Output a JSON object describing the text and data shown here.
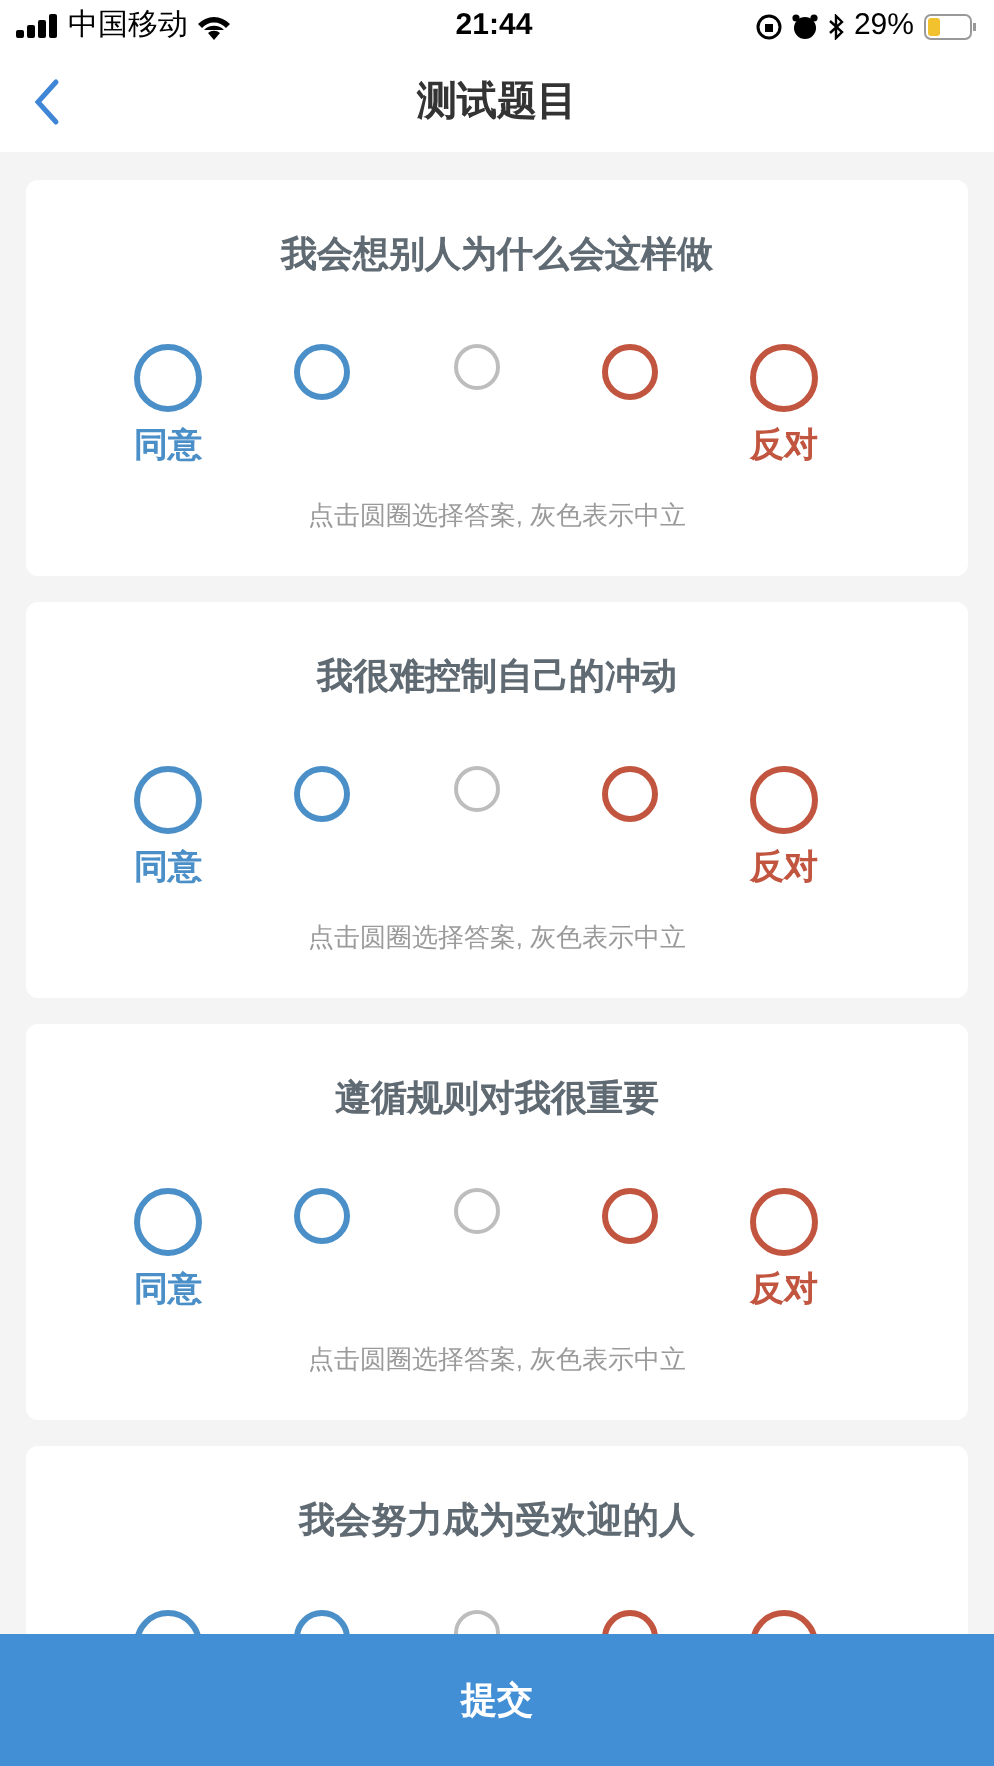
{
  "status_bar": {
    "carrier": "中国移动",
    "time": "21:44",
    "battery": "29%"
  },
  "nav": {
    "title": "测试题目"
  },
  "questions": [
    {
      "title": "我会想别人为什么会这样做",
      "hint": "点击圆圈选择答案, 灰色表示中立",
      "options": [
        {
          "kind": "large",
          "color": "#4a8fc8",
          "selected": false,
          "label": "同意"
        },
        {
          "kind": "medium",
          "color": "#4a8fc8",
          "selected": false
        },
        {
          "kind": "small",
          "color": "#bdbdbd",
          "selected": false
        },
        {
          "kind": "medium",
          "color": "#c2553f",
          "selected": false
        },
        {
          "kind": "large",
          "color": "#c2553f",
          "selected": false,
          "label": "反对"
        }
      ]
    },
    {
      "title": "我很难控制自己的冲动",
      "hint": "点击圆圈选择答案, 灰色表示中立",
      "options": [
        {
          "kind": "large",
          "color": "#4a8fc8",
          "selected": false,
          "label": "同意"
        },
        {
          "kind": "medium",
          "color": "#4a8fc8",
          "selected": false
        },
        {
          "kind": "small",
          "color": "#bdbdbd",
          "selected": false
        },
        {
          "kind": "medium",
          "color": "#c2553f",
          "selected": false
        },
        {
          "kind": "large",
          "color": "#c2553f",
          "selected": false,
          "label": "反对"
        }
      ]
    },
    {
      "title": "遵循规则对我很重要",
      "hint": "点击圆圈选择答案, 灰色表示中立",
      "options": [
        {
          "kind": "large",
          "color": "#4a8fc8",
          "selected": false,
          "label": "同意"
        },
        {
          "kind": "medium",
          "color": "#4a8fc8",
          "selected": false
        },
        {
          "kind": "small",
          "color": "#bdbdbd",
          "selected": false
        },
        {
          "kind": "medium",
          "color": "#c2553f",
          "selected": false
        },
        {
          "kind": "large",
          "color": "#c2553f",
          "selected": false,
          "label": "反对"
        }
      ]
    },
    {
      "title": "我会努力成为受欢迎的人",
      "options": [
        {
          "kind": "large",
          "color": "#4a8fc8",
          "selected": false
        },
        {
          "kind": "medium",
          "color": "#4a8fc8",
          "selected": false
        },
        {
          "kind": "small",
          "color": "#bdbdbd",
          "selected": false
        },
        {
          "kind": "medium",
          "color": "#c2553f",
          "selected": false
        },
        {
          "kind": "large",
          "color": "#c2553f",
          "selected": false
        }
      ]
    }
  ],
  "submit": {
    "label": "提交"
  }
}
